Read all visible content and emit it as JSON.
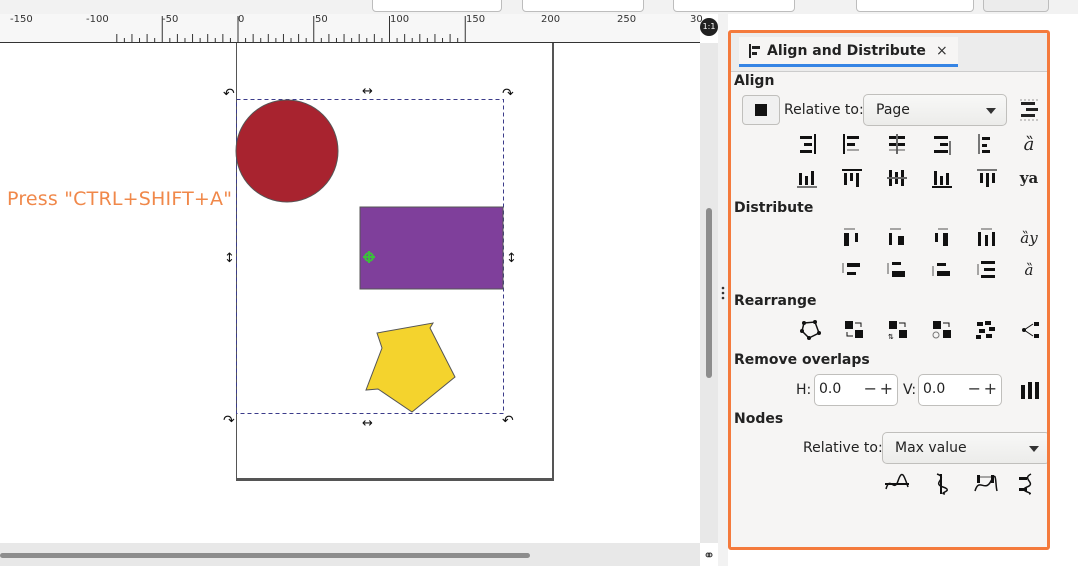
{
  "instruction": "Press \"CTRL+SHIFT+A\"",
  "ruler": {
    "labels": [
      "-150",
      "-100",
      "-50",
      "0",
      "50",
      "100",
      "150",
      "200",
      "250",
      "30"
    ],
    "corner": "1:1"
  },
  "panel": {
    "tab_title": "Align and Distribute",
    "close": "×",
    "align": {
      "title": "Align",
      "relative_label": "Relative to:",
      "relative_value": "Page"
    },
    "distribute": {
      "title": "Distribute"
    },
    "rearrange": {
      "title": "Rearrange"
    },
    "remove_overlaps": {
      "title": "Remove overlaps",
      "h_label": "H:",
      "h_value": "0.0",
      "v_label": "V:",
      "v_value": "0.0",
      "minus": "−",
      "plus": "+"
    },
    "nodes": {
      "title": "Nodes",
      "relative_label": "Relative to:",
      "relative_value": "Max value"
    }
  },
  "colors": {
    "circle": "#a8232f",
    "rect": "#7f3f9b",
    "star": "#f4d32d",
    "instruction": "#f0884a",
    "panel_highlight": "#f47a3c",
    "tab_underline": "#3584e4"
  },
  "icons": {
    "align_row1": [
      "align-right-edge-icon",
      "align-left-edge-icon",
      "center-vertical-axis-icon",
      "align-right-icon",
      "align-left-anchor-icon",
      "text-baseline-icon"
    ],
    "align_row2": [
      "align-bottom-edge-icon",
      "align-top-anchor-icon",
      "center-horizontal-axis-icon",
      "align-bottom-icon",
      "align-top-edge-icon",
      "text-baseline-horizontal-icon"
    ]
  }
}
